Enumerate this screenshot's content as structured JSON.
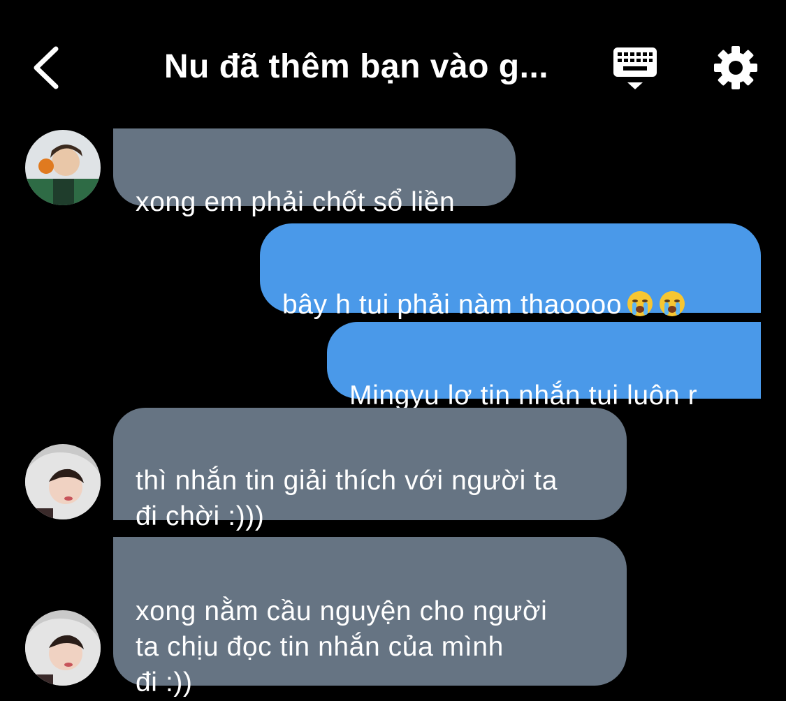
{
  "header": {
    "back_icon": "chevron-left-icon",
    "title": "Nu đã thêm bạn vào g...",
    "keyboard_icon": "keyboard-hide-icon",
    "settings_icon": "gear-icon"
  },
  "messages": [
    {
      "direction": "incoming",
      "text": "xong em phải chốt sổ liền"
    },
    {
      "direction": "outgoing",
      "text": "bây h tui phải nàm thaoooo",
      "emoji": [
        "loudly-crying-face",
        "loudly-crying-face"
      ]
    },
    {
      "direction": "outgoing",
      "text": "Mingyu lơ tin nhắn tui luôn r"
    },
    {
      "direction": "incoming",
      "text": "thì nhắn tin giải thích với người ta\nđi chời :)))"
    },
    {
      "direction": "incoming",
      "text": "xong nằm cầu nguyện cho người\nta chịu đọc tin nhắn của mình\nđi :))"
    }
  ],
  "colors": {
    "background": "#000000",
    "incoming_bubble": "#667483",
    "outgoing_bubble": "#4a99e9",
    "text": "#ffffff"
  }
}
